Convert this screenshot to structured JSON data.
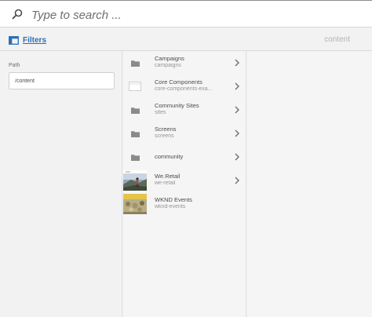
{
  "search": {
    "placeholder": "Type to search ...",
    "icon": "search-icon"
  },
  "toolbar": {
    "filters_label": "Filters",
    "filters_icon": "rail-toggle-icon",
    "title": "content"
  },
  "rail": {
    "path_label": "Path",
    "path_value": "/content"
  },
  "colors": {
    "accent": "#2b6fb5",
    "background": "#f2f2f2",
    "folder_icon": "#8a8a8a"
  },
  "items": [
    {
      "title": "Campaigns",
      "subtitle": "campaigns",
      "thumb": "folder-icon",
      "has_children": true
    },
    {
      "title": "Core Components",
      "subtitle": "core-components-exa...",
      "thumb": "page-icon",
      "has_children": true
    },
    {
      "title": "Community Sites",
      "subtitle": "sites",
      "thumb": "folder-icon",
      "has_children": true
    },
    {
      "title": "Screens",
      "subtitle": "screens",
      "thumb": "folder-icon",
      "has_children": true
    },
    {
      "title": "community",
      "subtitle": "",
      "thumb": "folder-icon",
      "has_children": true
    },
    {
      "title": "We.Retail",
      "subtitle": "we-retail",
      "thumb": "we-retail-thumbnail",
      "has_children": true
    },
    {
      "title": "WKND Events",
      "subtitle": "wknd-events",
      "thumb": "wknd-thumbnail",
      "has_children": false
    }
  ]
}
